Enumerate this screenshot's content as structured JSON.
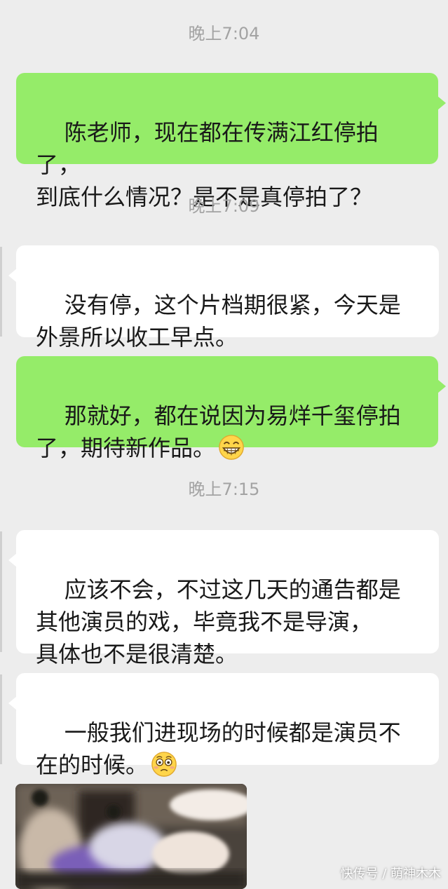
{
  "chat": {
    "timestamps": [
      "晚上7:04",
      "晚上7:09",
      "晚上7:15"
    ],
    "messages": [
      {
        "direction": "sent",
        "text": "陈老师，现在都在传满江红停拍了，\n到底什么情况？是不是真停拍了？"
      },
      {
        "direction": "received",
        "text": "没有停，这个片档期很紧，今天是\n外景所以收工早点。"
      },
      {
        "direction": "sent",
        "text": "那就好，都在说因为易烊千玺停拍\n了，期待新作品。",
        "emoji": "grinning-face-emoji"
      },
      {
        "direction": "received",
        "text": "应该不会，不过这几天的通告都是\n其他演员的戏，毕竟我不是导演，\n具体也不是很清楚。"
      },
      {
        "direction": "received",
        "text": "一般我们进现场的时候都是演员不\n在的时候。",
        "emoji": "flushed-face-emoji"
      }
    ],
    "photo": {
      "kind": "blurred-set-photo"
    }
  },
  "watermark": {
    "text": "快传号 / 萌神木木"
  },
  "colors": {
    "background": "#ededed",
    "sent_bubble": "#95ec69",
    "received_bubble": "#ffffff",
    "timestamp": "#a3a3a3",
    "message_text": "#191919"
  }
}
